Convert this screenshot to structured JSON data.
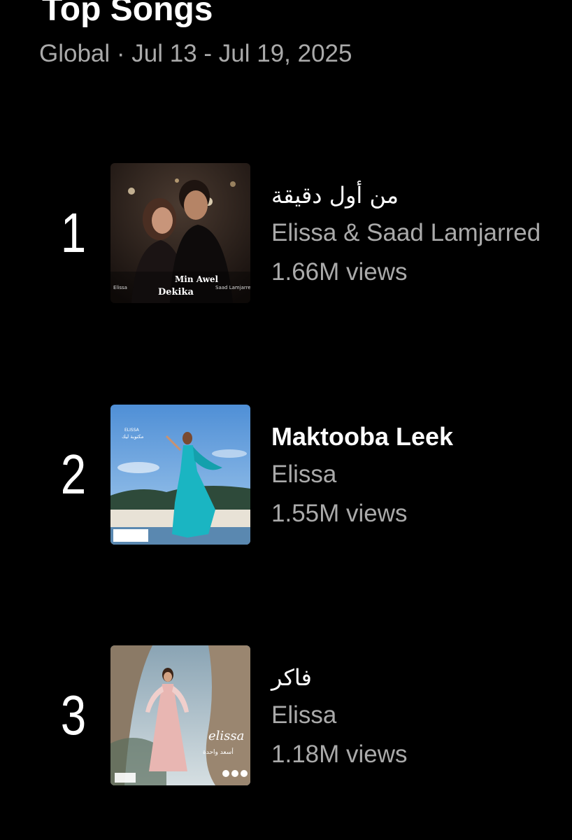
{
  "header": {
    "title": "Top Songs",
    "subtitle": "Global · Jul 13 - Jul 19, 2025"
  },
  "songs": [
    {
      "rank": "1",
      "title": "من أول دقيقة",
      "artist": "Elissa & Saad Lamjarred",
      "views": "1.66M views",
      "cover_text": [
        "Min Awel",
        "Dekika",
        "Elissa",
        "Saad Lamjarred"
      ]
    },
    {
      "rank": "2",
      "title": "Maktooba Leek",
      "artist": "Elissa",
      "views": "1.55M views",
      "cover_text": [
        "ELISSA",
        "مكتوبة ليك"
      ]
    },
    {
      "rank": "3",
      "title": "فاكر",
      "artist": "Elissa",
      "views": "1.18M views",
      "cover_text": [
        "elissa",
        "أسعد واحدة"
      ]
    }
  ],
  "colors": {
    "background": "#000000",
    "primary_text": "#ffffff",
    "secondary_text": "#aaaaaa"
  }
}
